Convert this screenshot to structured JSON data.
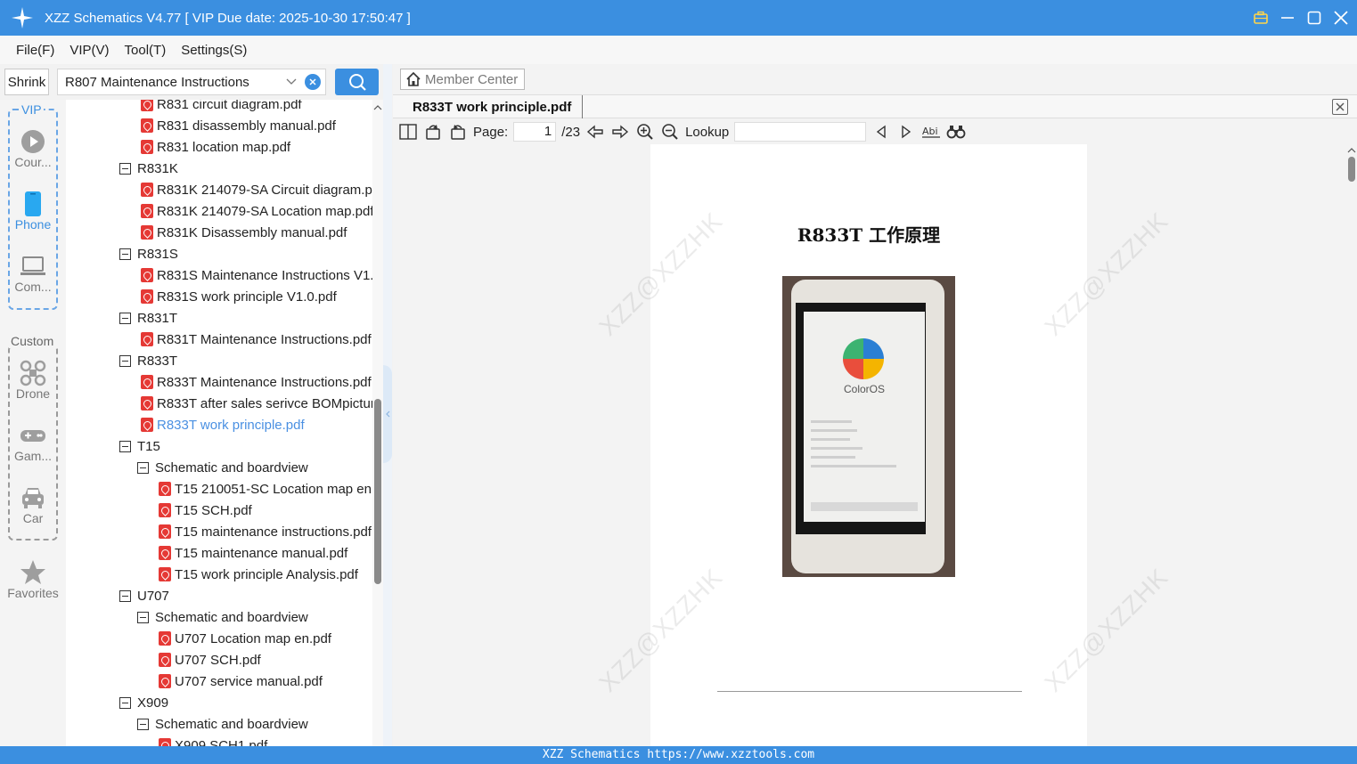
{
  "window": {
    "title": "XZZ Schematics V4.77 [ VIP Due date: 2025-10-30 17:50:47 ]"
  },
  "menu": [
    "File(F)",
    "VIP(V)",
    "Tool(T)",
    "Settings(S)"
  ],
  "search": {
    "shrink_label": "Shrink",
    "value": "R807 Maintenance Instructions"
  },
  "rail": {
    "vip_label": "VIP",
    "custom_label": "Custom",
    "items": [
      {
        "label": "Cour...",
        "icon": "play-circle-icon"
      },
      {
        "label": "Phone",
        "icon": "phone-icon"
      },
      {
        "label": "Com...",
        "icon": "laptop-icon"
      },
      {
        "label": "Drone",
        "icon": "drone-icon"
      },
      {
        "label": "Gam...",
        "icon": "gamepad-icon"
      },
      {
        "label": "Car",
        "icon": "car-icon"
      },
      {
        "label": "Favorites",
        "icon": "star-icon"
      }
    ]
  },
  "tree": [
    {
      "type": "file",
      "level": 1,
      "label": "R831 circuit diagram.pdf"
    },
    {
      "type": "file",
      "level": 1,
      "label": "R831 disassembly manual.pdf"
    },
    {
      "type": "file",
      "level": 1,
      "label": "R831 location map.pdf"
    },
    {
      "type": "folder",
      "level": 0,
      "label": "R831K"
    },
    {
      "type": "file",
      "level": 1,
      "label": "R831K 214079-SA Circuit diagram.pc"
    },
    {
      "type": "file",
      "level": 1,
      "label": "R831K 214079-SA Location map.pdf"
    },
    {
      "type": "file",
      "level": 1,
      "label": "R831K Disassembly manual.pdf"
    },
    {
      "type": "folder",
      "level": 0,
      "label": "R831S"
    },
    {
      "type": "file",
      "level": 1,
      "label": "R831S Maintenance Instructions V1.:"
    },
    {
      "type": "file",
      "level": 1,
      "label": "R831S work principle V1.0.pdf"
    },
    {
      "type": "folder",
      "level": 0,
      "label": "R831T"
    },
    {
      "type": "file",
      "level": 1,
      "label": "R831T Maintenance Instructions.pdf"
    },
    {
      "type": "folder",
      "level": 0,
      "label": "R833T"
    },
    {
      "type": "file",
      "level": 1,
      "label": "R833T Maintenance Instructions.pdf"
    },
    {
      "type": "file",
      "level": 1,
      "label": "R833T after sales serivce BOMpicture"
    },
    {
      "type": "file",
      "level": 1,
      "label": "R833T work principle.pdf",
      "selected": true
    },
    {
      "type": "folder",
      "level": 0,
      "label": "T15"
    },
    {
      "type": "folder",
      "level": 1,
      "label": "Schematic and boardview"
    },
    {
      "type": "file",
      "level": 2,
      "label": "T15 210051-SC Location map en.p"
    },
    {
      "type": "file",
      "level": 2,
      "label": "T15 SCH.pdf"
    },
    {
      "type": "file",
      "level": 2,
      "label": "T15 maintenance instructions.pdf"
    },
    {
      "type": "file",
      "level": 2,
      "label": "T15 maintenance manual.pdf"
    },
    {
      "type": "file",
      "level": 2,
      "label": "T15 work principle Analysis.pdf"
    },
    {
      "type": "folder",
      "level": 0,
      "label": "U707"
    },
    {
      "type": "folder",
      "level": 1,
      "label": "Schematic and boardview"
    },
    {
      "type": "file",
      "level": 2,
      "label": "U707 Location map en.pdf"
    },
    {
      "type": "file",
      "level": 2,
      "label": "U707 SCH.pdf"
    },
    {
      "type": "file",
      "level": 2,
      "label": "U707 service manual.pdf"
    },
    {
      "type": "folder",
      "level": 0,
      "label": "X909"
    },
    {
      "type": "folder",
      "level": 1,
      "label": "Schematic and boardview"
    },
    {
      "type": "file",
      "level": 2,
      "label": "X909 SCH1.pdf"
    }
  ],
  "viewer": {
    "member_center": "Member Center",
    "tab_title": "R833T work principle.pdf",
    "page_label": "Page:",
    "page_value": "1",
    "page_total": "/23",
    "lookup_label": "Lookup",
    "lookup_value": "",
    "doc_title": "R833T 工作原理",
    "watermark": "XZZ@XZZHK",
    "phone_brand": "ColorOS"
  },
  "status": "XZZ Schematics https://www.xzztools.com",
  "colors": {
    "accent": "#3b8fe0",
    "pdf": "#e53935",
    "selected_text": "#4a90e2"
  }
}
